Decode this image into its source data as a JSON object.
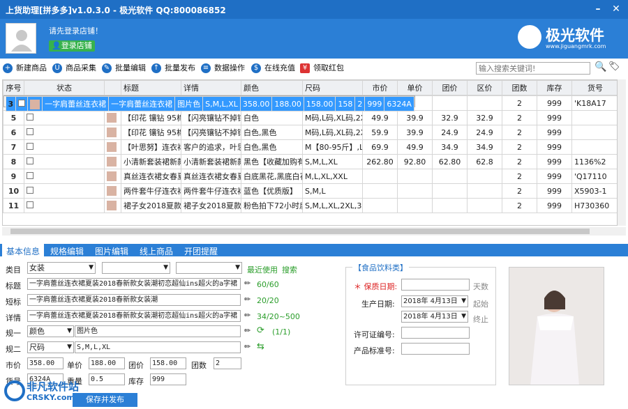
{
  "window": {
    "title": "上货助理[拼多多]v1.0.3.0 - 极光软件 QQ:800086852"
  },
  "header": {
    "login_msg": "请先登录店铺！",
    "login_button": "登录店铺",
    "brand_name": "极光软件",
    "brand_url": "www.jiguangmrk.com"
  },
  "toolbar": {
    "items": [
      "新建商品",
      "商品采集",
      "批量编辑",
      "批量发布",
      "数据操作",
      "在线充值",
      "领取红包"
    ],
    "search_placeholder": "输入搜索关键词!"
  },
  "table": {
    "headers": [
      "序号",
      "状态",
      "",
      "标题",
      "详情",
      "颜色",
      "尺码",
      "市价",
      "单价",
      "团价",
      "区价",
      "团数",
      "库存",
      "货号"
    ],
    "rows": [
      [
        "3",
        "",
        "",
        "一字肩蕾丝连衣裙",
        "一字肩蕾丝连衣裙",
        "图片色",
        "S,M,L,XL",
        "358.00",
        "188.00",
        "158.00",
        "158",
        "2",
        "999",
        "6324A"
      ],
      [
        "4",
        "",
        "",
        "连衣裙女春中长款",
        "连衣裙女春中长款",
        "红格,藏青格",
        "160/M,165/L,170",
        "",
        "",
        "",
        "",
        "2",
        "999",
        "'K18A17"
      ],
      [
        "5",
        "",
        "",
        "【印花 镶钻 95棉",
        "【闪亮镶钻不掉钻",
        "白色",
        "M码,L码,XL码,2X",
        "49.9",
        "39.9",
        "32.9",
        "32.9",
        "2",
        "999",
        ""
      ],
      [
        "6",
        "",
        "",
        "【印花 镶钻 95棉",
        "【闪亮镶钻不掉钻",
        "白色,黑色",
        "M码,L码,XL码,2X",
        "59.9",
        "39.9",
        "24.9",
        "24.9",
        "2",
        "999",
        ""
      ],
      [
        "7",
        "",
        "",
        "【叶思努】连衣裙",
        "客户的追求，叶思",
        "白色,黑色",
        "M【80-95斤】,L【",
        "69.9",
        "49.9",
        "34.9",
        "34.9",
        "2",
        "999",
        ""
      ],
      [
        "8",
        "",
        "",
        "小清新套装裙新款",
        "小清新套装裙新款",
        "黑色【收藏加购有",
        "S,M,L,XL",
        "262.80",
        "92.80",
        "62.80",
        "62.8",
        "2",
        "999",
        "1136%2"
      ],
      [
        "9",
        "",
        "",
        "真丝连衣裙女春夏",
        "真丝连衣裙女春夏",
        "白底黑花,黑底白花",
        "M,L,XL,XXL",
        "",
        "",
        "",
        "",
        "2",
        "999",
        "'Q17110"
      ],
      [
        "10",
        "",
        "",
        "两件套牛仔连衣裙",
        "两件套牛仔连衣裙",
        "蓝色【优质版】",
        "S,M,L",
        "",
        "",
        "",
        "",
        "2",
        "999",
        "X5903-1"
      ],
      [
        "11",
        "",
        "",
        "裙子女2018夏款新",
        "裙子女2018夏款新",
        "粉色拍下72小时后",
        "S,M,L,XL,2XL,3XL",
        "",
        "",
        "",
        "",
        "2",
        "999",
        "H730360"
      ]
    ]
  },
  "tabs": [
    "基本信息",
    "规格编辑",
    "图片编辑",
    "线上商品",
    "开团提醒"
  ],
  "form": {
    "category_label": "类目",
    "category_value": "女装",
    "recent": "最近使用",
    "search": "搜索",
    "title_label": "标题",
    "title_value": "一字肩蕾丝连衣裙夏装2018春新款女装潮初恋超仙ins超火的a字裙",
    "title_count": "60/60",
    "short_label": "短标",
    "short_value": "一字肩蕾丝连衣裙夏装2018春新款女装潮",
    "short_count": "20/20",
    "detail_label": "详情",
    "detail_value": "一字肩蕾丝连衣裙夏装2018春新款女装潮初恋超仙ins超火的a字裙",
    "detail_count": "34/20~500",
    "spec1_label": "规一",
    "spec1_select": "颜色",
    "spec1_value": "图片色",
    "spec1_count": "(1/1)",
    "spec2_label": "规二",
    "spec2_select": "尺码",
    "spec2_value": "S,M,L,XL",
    "market_label": "市价",
    "market_value": "358.00",
    "unit_label": "单价",
    "unit_value": "188.00",
    "group_label": "团价",
    "group_value": "158.00",
    "groupnum_label": "团数",
    "groupnum_value": "2",
    "sku_label": "货号",
    "sku_value": "6324A",
    "weight_label": "重量",
    "weight_value": "0.5",
    "stock_label": "库存",
    "stock_value": "999",
    "save_button": "保存并发布"
  },
  "food": {
    "title": "【食品饮料类】",
    "shelf_label": "＊ 保质日期:",
    "shelf_unit": "天数",
    "prod_label": "生产日期:",
    "date1": "2018年 4月13日",
    "start": "起始",
    "date2": "2018年 4月13日",
    "end": "终止",
    "license_label": "许可证编号:",
    "std_label": "产品标准号:"
  },
  "watermark": {
    "text1": "非凡软件站",
    "text2": "CRSKY.com"
  }
}
